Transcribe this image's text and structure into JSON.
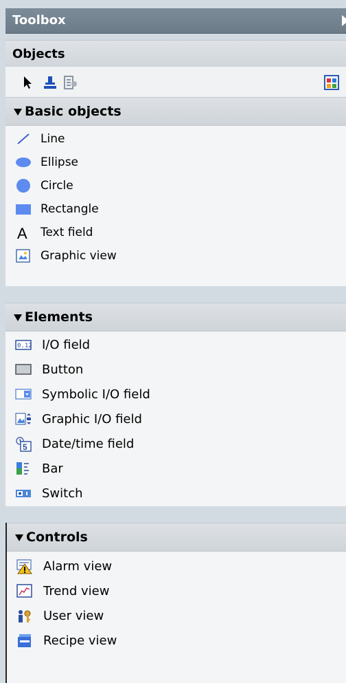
{
  "window": {
    "title": "Toolbox"
  },
  "objects": {
    "label": "Objects"
  },
  "toolbar": {
    "tools": [
      {
        "icon": "pointer-icon"
      },
      {
        "icon": "stamp-icon"
      },
      {
        "icon": "properties-icon"
      },
      {
        "icon": "grid-icon"
      }
    ]
  },
  "basic_objects": {
    "label": "Basic objects",
    "items": [
      {
        "label": "Line",
        "icon": "line-icon"
      },
      {
        "label": "Ellipse",
        "icon": "ellipse-icon"
      },
      {
        "label": "Circle",
        "icon": "circle-icon"
      },
      {
        "label": "Rectangle",
        "icon": "rectangle-icon"
      },
      {
        "label": "Text field",
        "icon": "text-field-icon"
      },
      {
        "label": "Graphic view",
        "icon": "graphic-view-icon"
      }
    ]
  },
  "elements": {
    "label": "Elements",
    "items": [
      {
        "label": "I/O field",
        "icon": "io-field-icon"
      },
      {
        "label": "Button",
        "icon": "button-icon"
      },
      {
        "label": "Symbolic I/O field",
        "icon": "symbolic-io-field-icon"
      },
      {
        "label": "Graphic I/O field",
        "icon": "graphic-io-field-icon"
      },
      {
        "label": "Date/time field",
        "icon": "date-time-field-icon"
      },
      {
        "label": "Bar",
        "icon": "bar-icon"
      },
      {
        "label": "Switch",
        "icon": "switch-icon"
      }
    ]
  },
  "controls": {
    "label": "Controls",
    "items": [
      {
        "label": "Alarm view",
        "icon": "alarm-view-icon"
      },
      {
        "label": "Trend view",
        "icon": "trend-view-icon"
      },
      {
        "label": "User view",
        "icon": "user-view-icon"
      },
      {
        "label": "Recipe view",
        "icon": "recipe-view-icon"
      }
    ]
  }
}
